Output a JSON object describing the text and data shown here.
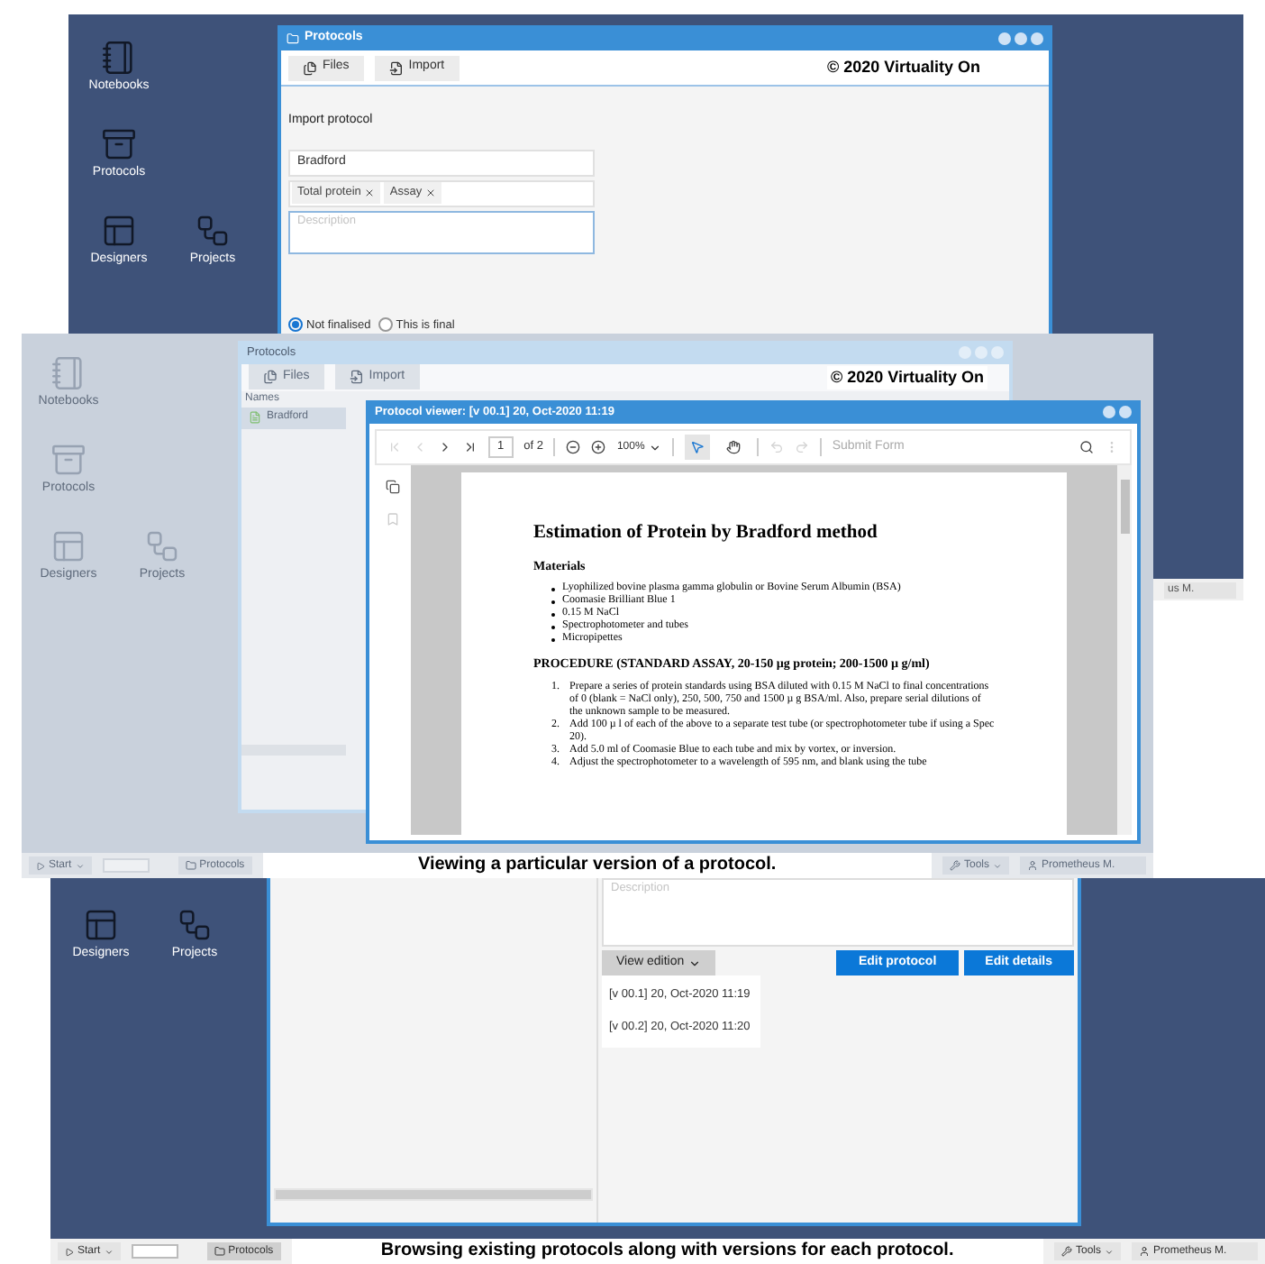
{
  "top_screen": {
    "desktop_icons": [
      {
        "kind": "notebook",
        "label": "Notebooks"
      },
      {
        "kind": "archive",
        "label": "Protocols"
      },
      {
        "kind": "layout",
        "label": "Designers"
      },
      {
        "kind": "graph",
        "label": "Projects"
      }
    ],
    "window": {
      "title": "Protocols",
      "toolbar": [
        {
          "kind": "files",
          "label": "Files"
        },
        {
          "kind": "import",
          "label": "Import"
        }
      ],
      "watermark": "© 2020 Virtuality On",
      "heading": "Import protocol",
      "name_value": "Bradford",
      "tags": [
        "Total protein",
        "Assay"
      ],
      "description_placeholder": "Description",
      "radios": [
        {
          "label": "Not finalised",
          "selected": true
        },
        {
          "label": "This is final",
          "selected": false
        }
      ]
    },
    "taskbar_user": "us M."
  },
  "middle_screen": {
    "desktop_icons": [
      {
        "kind": "notebook",
        "label": "Notebooks"
      },
      {
        "kind": "archive",
        "label": "Protocols"
      },
      {
        "kind": "layout",
        "label": "Designers"
      },
      {
        "kind": "graph",
        "label": "Projects"
      }
    ],
    "window": {
      "title": "Protocols",
      "toolbar": [
        {
          "kind": "files",
          "label": "Files"
        },
        {
          "kind": "import",
          "label": "Import"
        }
      ],
      "column": "Names",
      "rows": [
        {
          "label": "Bradford",
          "selected": true
        }
      ]
    },
    "watermark": "© 2020 Virtuality On",
    "viewer": {
      "title": "Protocol viewer: [v 00.1] 20, Oct-2020 11:19",
      "nav": [
        {
          "kind": "first",
          "disabled": true
        },
        {
          "kind": "prev",
          "disabled": true
        },
        {
          "kind": "next",
          "disabled": false
        },
        {
          "kind": "last",
          "disabled": false
        }
      ],
      "page": "1",
      "page_total": "of 2",
      "zoom": "100%",
      "tools": [
        {
          "kind": "select",
          "selected": true
        },
        {
          "kind": "pan",
          "selected": false
        }
      ],
      "history": [
        {
          "kind": "undo",
          "disabled": true
        },
        {
          "kind": "redo",
          "disabled": true
        }
      ],
      "submit": {
        "label": "Submit Form",
        "disabled": true
      },
      "document": {
        "title": "Estimation of Protein by Bradford method",
        "materials_heading": "Materials",
        "materials": [
          "Lyophilized bovine plasma gamma globulin or Bovine Serum Albumin (BSA)",
          "Coomasie Brilliant Blue 1",
          "0.15 M NaCl",
          "Spectrophotometer and tubes",
          "Micropipettes"
        ],
        "procedure_heading": "PROCEDURE (STANDARD ASSAY, 20-150 µg protein; 200-1500 µ g/ml)",
        "steps": [
          {
            "number": "1.",
            "text": "Prepare a series of protein standards using BSA diluted with 0.15 M NaCl to final concentrations of 0 (blank = NaCl only), 250, 500, 750 and 1500 µ g BSA/ml. Also, prepare serial dilutions of the unknown sample to be measured."
          },
          {
            "number": "2.",
            "text": "Add 100 µ l of each of the above to a separate test tube (or spectrophotometer tube if using a Spec 20)."
          },
          {
            "number": "3.",
            "text": "Add 5.0 ml of Coomasie Blue to each tube and mix by vortex, or inversion."
          },
          {
            "number": "4.",
            "text": "Adjust the spectrophotometer to a wavelength of 595 nm, and blank using the tube"
          }
        ]
      }
    },
    "taskbar": {
      "start": "Start",
      "window": "Protocols",
      "tools": "Tools",
      "user": "Prometheus M."
    },
    "caption": "Viewing a particular version of a protocol."
  },
  "bottom_screen": {
    "desktop_icons": [
      {
        "kind": "layout",
        "label": "Designers"
      },
      {
        "kind": "graph",
        "label": "Projects"
      }
    ],
    "description_placeholder": "Description",
    "view_edition": "View edition",
    "versions": [
      {
        "label": "[v 00.1] 20, Oct-2020 11:19",
        "selected": false
      },
      {
        "label": "[v 00.2] 20, Oct-2020 11:20",
        "selected": false
      }
    ],
    "buttons": [
      "Edit protocol",
      "Edit details"
    ],
    "taskbar": {
      "start": "Start",
      "window": "Protocols",
      "tools": "Tools",
      "user": "Prometheus M."
    },
    "caption": "Browsing existing protocols along with versions for each protocol."
  }
}
